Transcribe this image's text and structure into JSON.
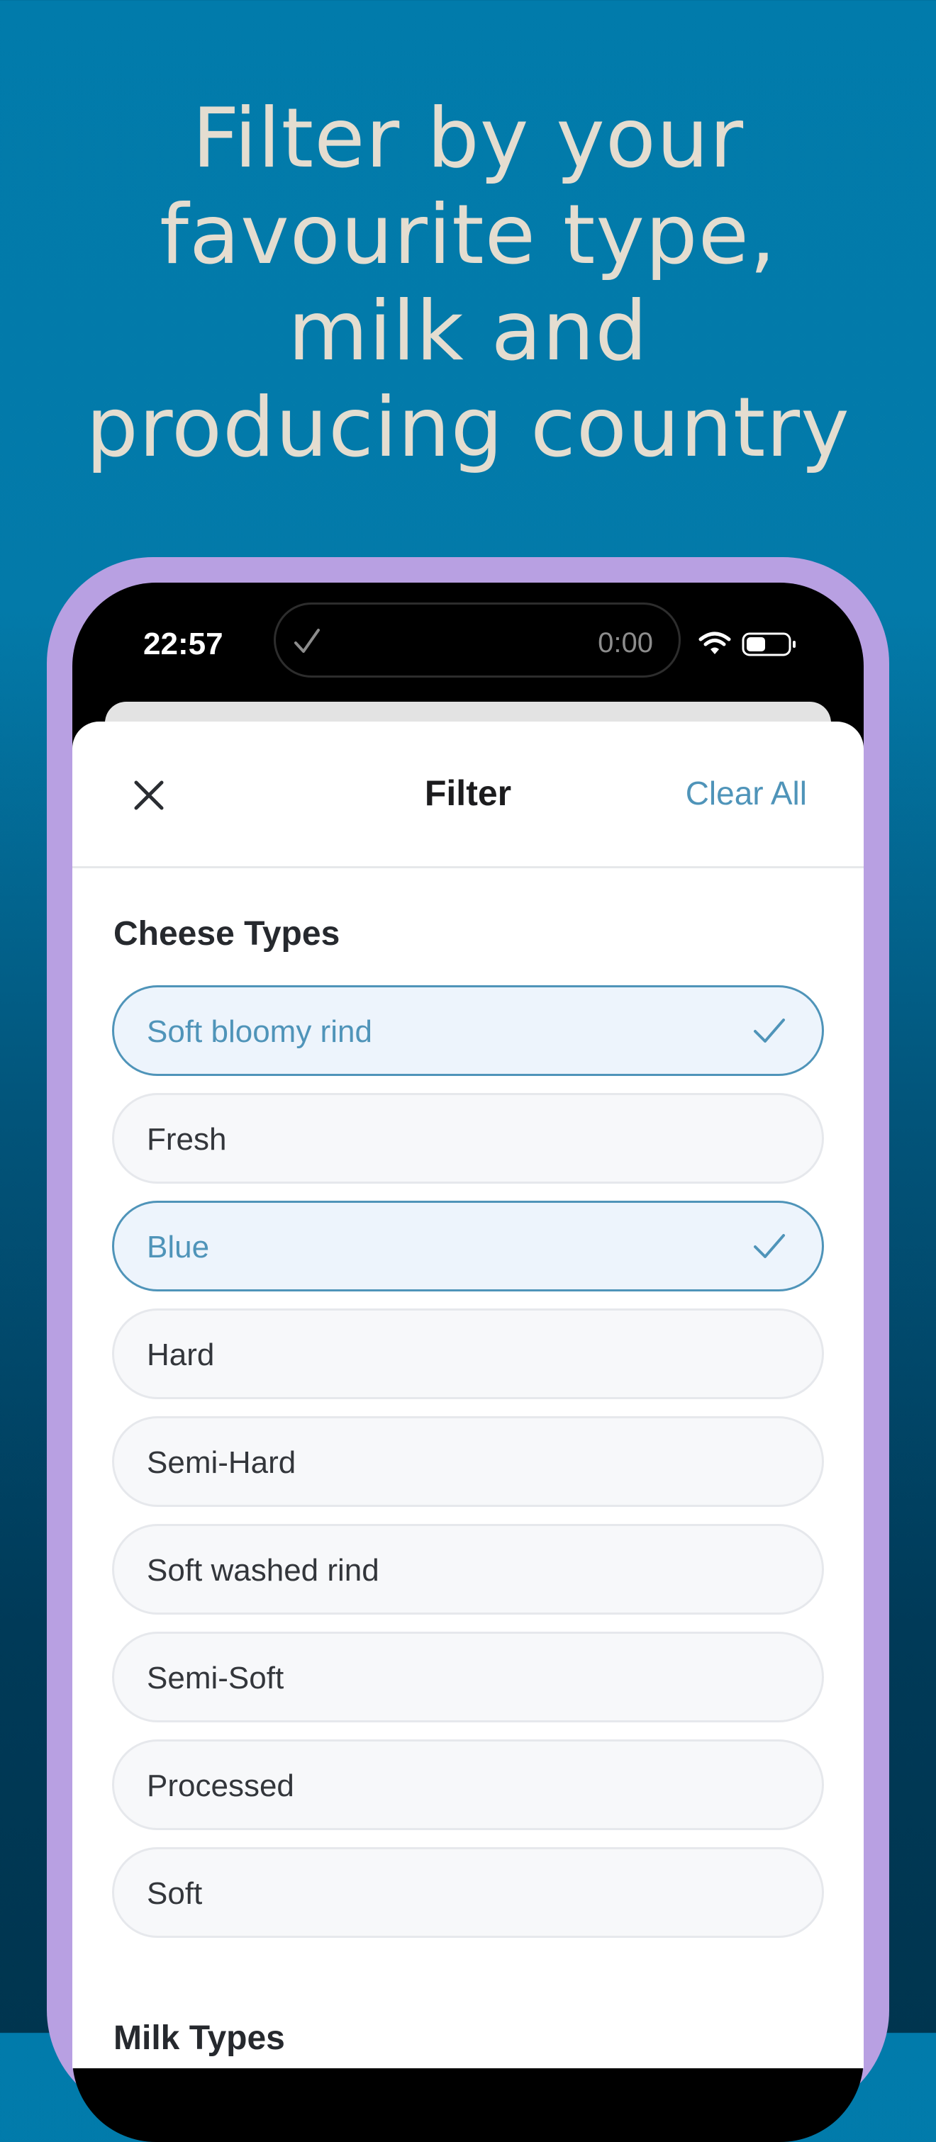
{
  "headline": {
    "lines": [
      "Filter by your",
      "favourite type,",
      "milk and",
      "producing country"
    ]
  },
  "status_bar": {
    "time": "22:57",
    "island_timer": "0:00"
  },
  "filter_sheet": {
    "title": "Filter",
    "clear_all_label": "Clear All",
    "cheese_types": {
      "heading": "Cheese Types",
      "options": [
        {
          "label": "Soft bloomy rind",
          "selected": true
        },
        {
          "label": "Fresh",
          "selected": false
        },
        {
          "label": "Blue",
          "selected": true
        },
        {
          "label": "Hard",
          "selected": false
        },
        {
          "label": "Semi-Hard",
          "selected": false
        },
        {
          "label": "Soft washed rind",
          "selected": false
        },
        {
          "label": "Semi-Soft",
          "selected": false
        },
        {
          "label": "Processed",
          "selected": false
        },
        {
          "label": "Soft",
          "selected": false
        }
      ]
    },
    "next_section_heading": "Milk Types"
  },
  "colors": {
    "accent": "#4f94b9",
    "frame": "#b8a0e2",
    "headline_text": "#e4ddd0",
    "selected_fill": "#edf4fc"
  },
  "icons": {
    "close": "close-icon",
    "check": "checkmark-icon",
    "wifi": "wifi-icon",
    "battery": "battery-icon"
  }
}
